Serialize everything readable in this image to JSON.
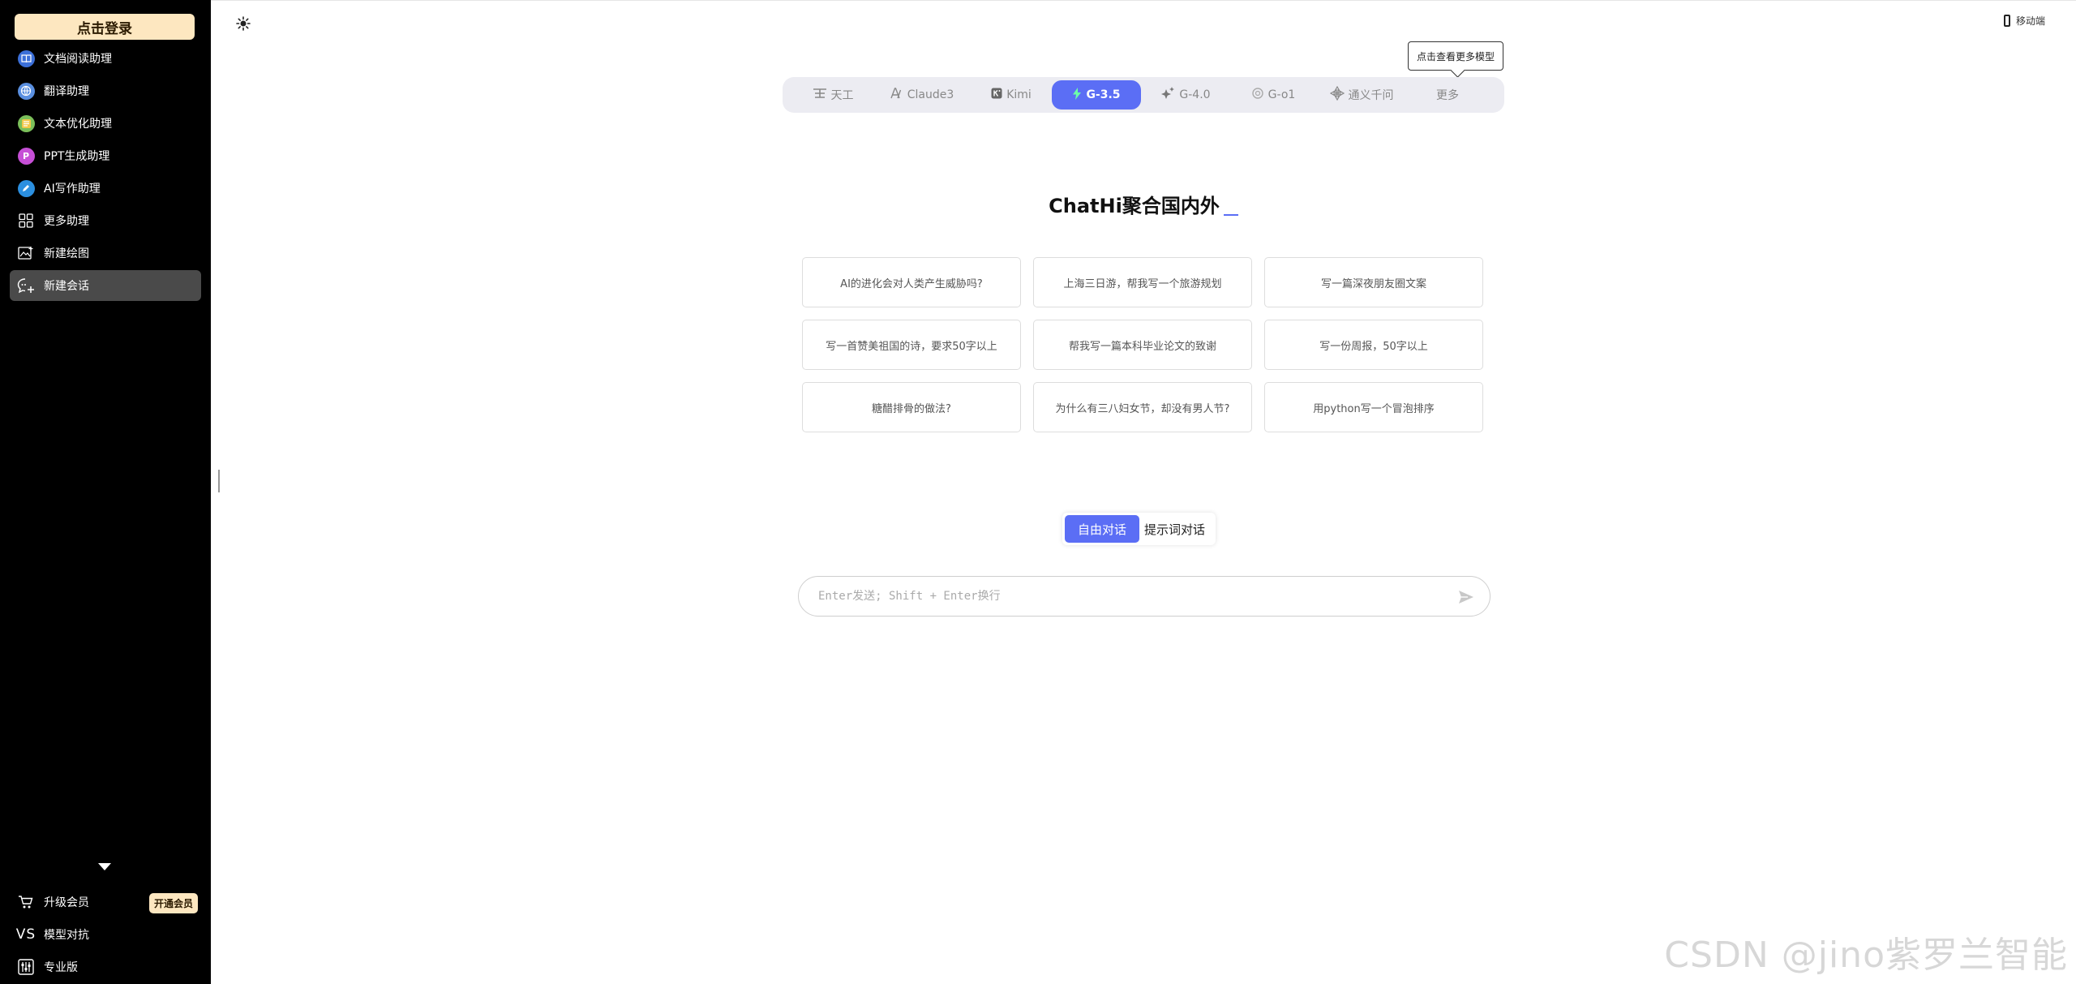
{
  "sidebar": {
    "login_label": "点击登录",
    "items": [
      {
        "label": "文档阅读助理",
        "icon": "book-icon"
      },
      {
        "label": "翻译助理",
        "icon": "translate-icon"
      },
      {
        "label": "文本优化助理",
        "icon": "text-optimize-icon"
      },
      {
        "label": "PPT生成助理",
        "icon": "ppt-icon"
      },
      {
        "label": "AI写作助理",
        "icon": "ai-writing-icon"
      },
      {
        "label": "更多助理",
        "icon": "grid-icon"
      },
      {
        "label": "新建绘图",
        "icon": "image-icon"
      },
      {
        "label": "新建会话",
        "icon": "chat-icon",
        "active": true
      }
    ],
    "bottom": {
      "upgrade_label": "升级会员",
      "upgrade_badge": "开通会员",
      "vs_icon_text": "VS",
      "vs_label": "模型对抗",
      "pro_label": "专业版"
    }
  },
  "header": {
    "mobile_label": "移动端",
    "tooltip": "点击查看更多模型"
  },
  "models": [
    {
      "label": "天工",
      "icon": "tiangong-icon"
    },
    {
      "label": "Claude3",
      "icon": "claude-icon"
    },
    {
      "label": "Kimi",
      "icon": "kimi-icon"
    },
    {
      "label": "G-3.5",
      "icon": "lightning-icon",
      "active": true
    },
    {
      "label": "G-4.0",
      "icon": "sparkle-icon"
    },
    {
      "label": "G-o1",
      "icon": "openai-icon"
    },
    {
      "label": "通义千问",
      "icon": "tongyi-icon"
    },
    {
      "label": "更多",
      "icon": ""
    }
  ],
  "headline": "ChatHi聚合国内外",
  "suggestions": [
    "AI的进化会对人类产生威胁吗?",
    "上海三日游，帮我写一个旅游规划",
    "写一篇深夜朋友圈文案",
    "写一首赞美祖国的诗，要求50字以上",
    "帮我写一篇本科毕业论文的致谢",
    "写一份周报，50字以上",
    "糖醋排骨的做法?",
    "为什么有三八妇女节，却没有男人节?",
    "用python写一个冒泡排序"
  ],
  "modes": {
    "free": "自由对话",
    "prompt": "提示词对话"
  },
  "input": {
    "placeholder": "Enter发送; Shift + Enter换行",
    "value": ""
  },
  "watermark": "CSDN @jino紫罗兰智能",
  "colors": {
    "accent": "#5b6ef5",
    "gold": "#fde7c0",
    "sidebar_bg": "#000000"
  }
}
